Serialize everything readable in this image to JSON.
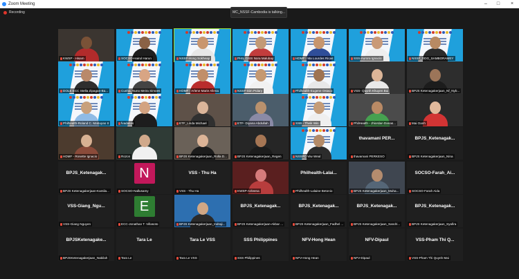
{
  "window": {
    "title": "Zoom Meeting",
    "recording_label": "Recording",
    "talking_banner": "MC_NSSF-Cambodia is talking..."
  },
  "colors": {
    "speaking_border": "#9be33d",
    "recording_dot": "#e0352b"
  },
  "participants": [
    {
      "label": "KWSP - Hisam",
      "kind": "video",
      "bg": "#3b3530",
      "skin": "#7a5237",
      "cloth": "#b22b2b"
    },
    {
      "label": "SOCSO-Hairul Harun",
      "kind": "poster",
      "skin": "#8a6246",
      "cloth": "#1e1e1e"
    },
    {
      "label": "NSSF-Hong Sokheap",
      "kind": "poster",
      "skin": "#c9966e",
      "cloth": "#e7e7e7",
      "speaking": true
    },
    {
      "label": "PHIL GSIS Nora Malubay",
      "kind": "poster",
      "skin": "#c39a76",
      "cloth": "#c23d3d"
    },
    {
      "label": "HDMF - Ma Lourdes Ricas",
      "kind": "poster",
      "skin": "#c8966e",
      "cloth": "#2f4e99"
    },
    {
      "label": "SSS-Aurora Ignacio",
      "kind": "poster",
      "skin": "#c99a78",
      "cloth": "#eeeeee"
    },
    {
      "label": "NSSF_DDG_SAMBORAMEY",
      "kind": "poster",
      "skin": "#b88a63",
      "cloth": "#2b2b2b"
    },
    {
      "label": "DOLE ECC Stella Zipagan-Ba...",
      "kind": "poster",
      "skin": "#b9896a",
      "cloth": "#2e2e2e"
    },
    {
      "label": "Cunha, Nuno Meira Simoes",
      "kind": "poster",
      "skin": "#d8a584",
      "cloth": "#444444"
    },
    {
      "label": "HDMF - Arlene Marie Allena",
      "kind": "poster",
      "skin": "#c18f6a",
      "cloth": "#b92d2d"
    },
    {
      "label": "NSSF-Sim Polary",
      "kind": "poster",
      "skin": "#c59871",
      "cloth": "#f1f1f1"
    },
    {
      "label": "Philhealth-Eugene Ostaco",
      "kind": "poster",
      "skin": "#9f7352",
      "cloth": "#e8e8e8"
    },
    {
      "label": "VSS- Quynh Khuyen Bui",
      "kind": "video",
      "bg": "#343434",
      "skin": "#dcb598",
      "cloth": "#e9e9e9"
    },
    {
      "label": "BPJS Ketenagakerjaan_Nf_Nyb...",
      "kind": "video",
      "bg": "#2d2d2d",
      "skin": "#9c7559",
      "cloth": "#1c1c1c"
    },
    {
      "label": "Philhealth-Roland C. Mabuyao II",
      "kind": "poster",
      "skin": "#c8a07c",
      "cloth": "#8fbbe5"
    },
    {
      "label": "fvadalias",
      "kind": "poster",
      "skin": "#d3a381",
      "cloth": "#1d1d1d"
    },
    {
      "label": "ETF_Linda Michael",
      "kind": "video",
      "bg": "#5e5148",
      "skin": "#dbb59a",
      "cloth": "#303030"
    },
    {
      "label": "ETF- Diyana Abdullah",
      "kind": "video",
      "bg": "#4b5d6b",
      "skin": "#b9916d",
      "cloth": "#8a8aa6"
    },
    {
      "label": "SSB - Theik Win",
      "kind": "poster",
      "skin": "#c59c77",
      "cloth": "#efefef"
    },
    {
      "label": "PhilHealth - Jhiordan Danas...",
      "kind": "video",
      "bg": "#4b4b4b",
      "skin": "#b98a65",
      "cloth": "#46a150"
    },
    {
      "label": "Mai Oanh",
      "kind": "video",
      "bg": "#2b2b2b",
      "skin": "#e1b99c",
      "cloth": "#d23434"
    },
    {
      "label": "HDMF - Rosette Ignacio",
      "kind": "video",
      "bg": "#4c3b2e",
      "skin": "#d8b193",
      "cloth": "#8a4b3a"
    },
    {
      "label": "Rozon",
      "kind": "video",
      "bg": "#2f3b36",
      "skin": "#d0a98b",
      "cloth": "#f0f0f0"
    },
    {
      "label": "BPJS Ketenagakerjaan_Rolla D...",
      "kind": "video",
      "bg": "#6a6158",
      "skin": "#dcb497",
      "cloth": "#1c1c1c"
    },
    {
      "label": "BPJS Ketenagakerjaan_Regen",
      "kind": "video",
      "bg": "#262626",
      "skin": "#a67654",
      "cloth": "#1c1c1c"
    },
    {
      "label": "NSSPC-Viw Weal",
      "kind": "poster",
      "skin": "#b48b68",
      "cloth": "#2c2c2c"
    },
    {
      "label": "thavamani PERKESO",
      "kind": "name",
      "big": "thavamani PER..."
    },
    {
      "label": "BPJS Ketenagakerjaan_Nina",
      "kind": "name",
      "big": "BPJS_Ketenagak..."
    },
    {
      "label": "BPJS Ketenagakerjaan-Kamila...",
      "kind": "name",
      "big": "BPJS_Ketenagak..."
    },
    {
      "label": "SOCSO-Nallusamy",
      "kind": "avatar",
      "letter": "N",
      "avatar_color": "#c2185b"
    },
    {
      "label": "VSS - Thu Ha",
      "kind": "name",
      "big": "VSS - Thu Ha"
    },
    {
      "label": "KWSP-Azleena",
      "kind": "video",
      "bg": "#5a1f1f",
      "skin": "#d67b7b",
      "cloth": "#b83d3d"
    },
    {
      "label": "Philhealth-Lalaine Betonio",
      "kind": "name",
      "big": "Philhealth-Lalai..."
    },
    {
      "label": "BPJS Ketenagakerjaan_Muha...",
      "kind": "video",
      "bg": "#3f4650",
      "skin": "#b48c6e",
      "cloth": "#556677"
    },
    {
      "label": "SOCSO-Farah Aida",
      "kind": "name",
      "big": "SOCSO-Farah_Ai..."
    },
    {
      "label": "VSS-Giang Nguyen",
      "kind": "name",
      "big": "VSS-Giang_Ngu..."
    },
    {
      "label": "ECC-Jonathan T. Villasoto",
      "kind": "avatar",
      "letter": "E",
      "avatar_color": "#2e7d32"
    },
    {
      "label": "BPJS Ketenagakerjaan_Indraji...",
      "kind": "video",
      "bg": "#2d6fb0",
      "skin": "#d0a785",
      "cloth": "#2a2a2a"
    },
    {
      "label": "BPJS Ketenagakerjaan-Akbar ...",
      "kind": "name",
      "big": "BPJS_Ketenagak..."
    },
    {
      "label": "BPJS Ketenagakerjaan_Fadhel ...",
      "kind": "name",
      "big": "BPJS_Ketenagak..."
    },
    {
      "label": "BPJS Ketenagakerjaan_Sandri...",
      "kind": "name",
      "big": "BPJS_Ketenagak..."
    },
    {
      "label": "BPJS Ketenagakerjaan_Syafira",
      "kind": "name",
      "big": "BPJS_Ketenagak..."
    },
    {
      "label": "BPJSKetenagakerjaan_Nabilah",
      "kind": "name",
      "big": "BPJSKetenagake..."
    },
    {
      "label": "Tara Le",
      "kind": "name",
      "big": "Tara Le"
    },
    {
      "label": "Tara Le VSS",
      "kind": "name",
      "big": "Tara Le VSS"
    },
    {
      "label": "SSS Philippines",
      "kind": "name",
      "big": "SSS Philippines"
    },
    {
      "label": "NFV-Hong Hean",
      "kind": "name",
      "big": "NFV-Hong Hean"
    },
    {
      "label": "NFV-Dipaul",
      "kind": "name",
      "big": "NFV-Dipaul"
    },
    {
      "label": "VSS-Pham Thi Quynh Mai",
      "kind": "name",
      "big": "VSS-Pham Thi Q..."
    }
  ]
}
